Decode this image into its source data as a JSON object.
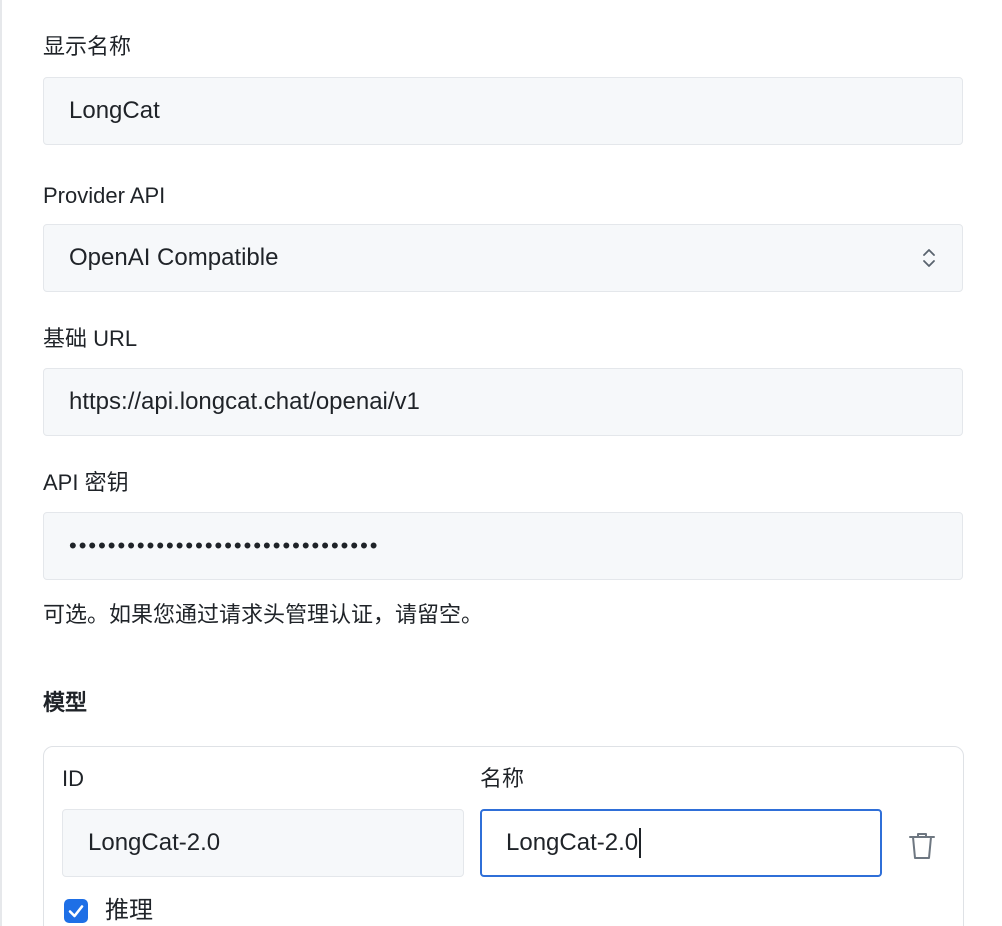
{
  "form": {
    "display_name_label": "显示名称",
    "display_name_value": "LongCat",
    "provider_api_label": "Provider API",
    "provider_api_value": "OpenAI Compatible",
    "base_url_label": "基础 URL",
    "base_url_value": "https://api.longcat.chat/openai/v1",
    "api_key_label": "API 密钥",
    "api_key_value": "••••••••••••••••••••••••••••••••",
    "api_key_hint": "可选。如果您通过请求头管理认证，请留空。"
  },
  "models": {
    "section_title": "模型",
    "id_label": "ID",
    "name_label": "名称",
    "items": [
      {
        "id": "LongCat-2.0",
        "name": "LongCat-2.0",
        "reasoning_label": "推理",
        "reasoning_checked": true
      }
    ]
  },
  "icons": {
    "select": "chevron-up-down-icon",
    "delete": "trash-icon",
    "check": "check-icon"
  },
  "colors": {
    "accent": "#1e6fe6",
    "focus_border": "#2f6fd8",
    "field_bg": "#f6f8fa"
  }
}
